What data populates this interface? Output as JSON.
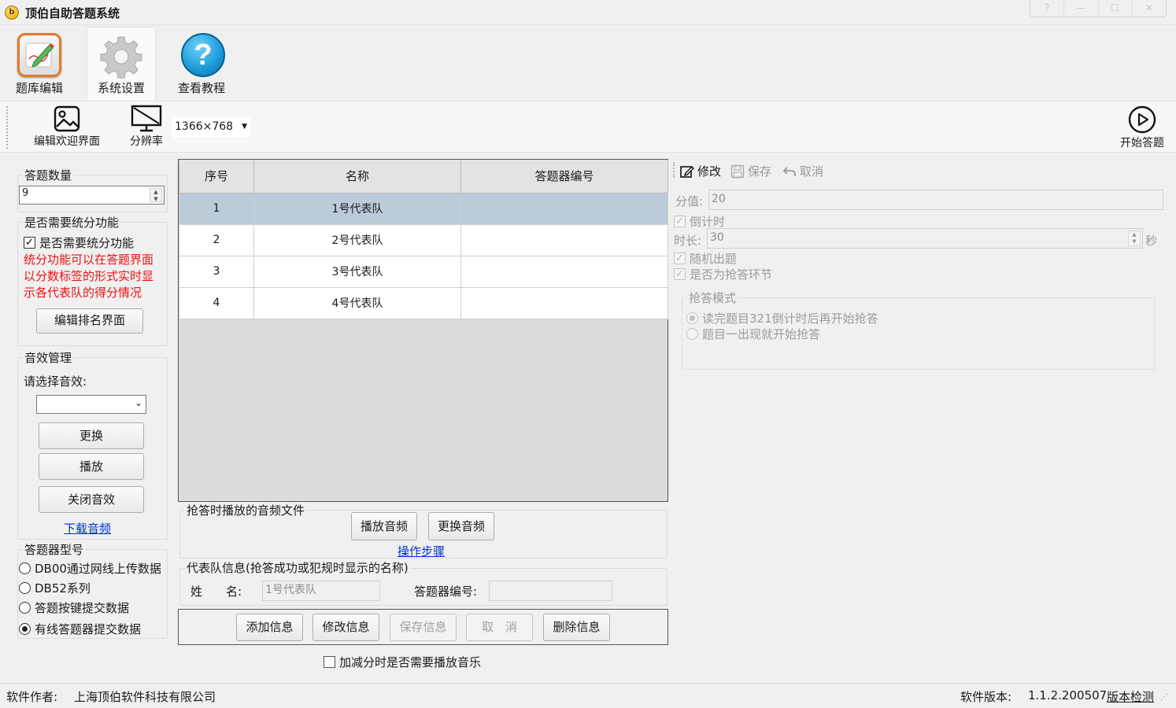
{
  "window": {
    "title": "顶伯自助答题系统",
    "icon_text": "b"
  },
  "ribbon": {
    "tabs": [
      {
        "label": "题库编辑",
        "icon": "pencil-edit-icon"
      },
      {
        "label": "系统设置",
        "icon": "gear-icon"
      },
      {
        "label": "查看教程",
        "icon": "help-icon"
      }
    ],
    "active_tab": "系统设置"
  },
  "toolbar": {
    "edit_welcome": "编辑欢迎界面",
    "resolution": "分辨率",
    "resolution_value": "1366×768",
    "start_answer": "开始答题"
  },
  "left": {
    "question_count": {
      "title": "答题数量",
      "value": "9"
    },
    "scoring": {
      "title": "是否需要统分功能",
      "checkbox": "是否需要统分功能",
      "checked": true,
      "note": "统分功能可以在答题界面以分数标签的形式实时显示各代表队的得分情况",
      "edit_rank_button": "编辑排名界面"
    },
    "sound": {
      "title": "音效管理",
      "select_label": "请选择音效:",
      "selected": "",
      "replace_button": "更换",
      "play_button": "播放",
      "close_button": "关闭音效",
      "download_link": "下载音频"
    },
    "device": {
      "title": "答题器型号",
      "options": [
        "DB00通过网线上传数据",
        "DB52系列",
        "答题按键提交数据",
        "有线答题器提交数据"
      ],
      "selected_index": 3
    }
  },
  "grid": {
    "columns": [
      "序号",
      "名称",
      "答题器编号"
    ],
    "rows": [
      [
        "1",
        "1号代表队",
        ""
      ],
      [
        "2",
        "2号代表队",
        ""
      ],
      [
        "3",
        "3号代表队",
        ""
      ],
      [
        "4",
        "4号代表队",
        ""
      ]
    ],
    "selected_row": 0
  },
  "audio": {
    "title": "抢答时播放的音频文件",
    "play_button": "播放音频",
    "replace_button": "更换音频",
    "steps_link": "操作步骤"
  },
  "team_info": {
    "title": "代表队信息(抢答成功或犯规时显示的名称)",
    "name_label": "姓　　名:",
    "name_value": "1号代表队",
    "device_label": "答题器编号:",
    "device_value": ""
  },
  "actions": {
    "add": "添加信息",
    "modify": "修改信息",
    "save": "保存信息",
    "cancel": "取　消",
    "delete": "删除信息"
  },
  "music_checkbox": {
    "label": "加减分时是否需要播放音乐",
    "checked": false
  },
  "right": {
    "toolbar": {
      "modify": "修改",
      "save": "保存",
      "cancel": "取消"
    },
    "score_label": "分值:",
    "score_value": "20",
    "countdown": {
      "label": "倒计时",
      "checked": true
    },
    "duration_label": "时长:",
    "duration_value": "30",
    "duration_unit": "秒",
    "random": {
      "label": "随机出题",
      "checked": true
    },
    "rush": {
      "label": "是否为抢答环节",
      "checked": true
    },
    "rush_mode": {
      "title": "抢答模式",
      "options": [
        "读完题目321倒计时后再开始抢答",
        "题目一出现就开始抢答"
      ],
      "selected_index": 0
    }
  },
  "status": {
    "author_label": "软件作者:",
    "author": "上海顶伯软件科技有限公司",
    "version_label": "软件版本:",
    "version": "1.1.2.200507",
    "check_link": "版本检测"
  },
  "colors": {
    "selected_row": "#bccbd9",
    "red_note": "#ee1111",
    "link": "#0033cc",
    "help_icon": "#1a9ad6"
  }
}
